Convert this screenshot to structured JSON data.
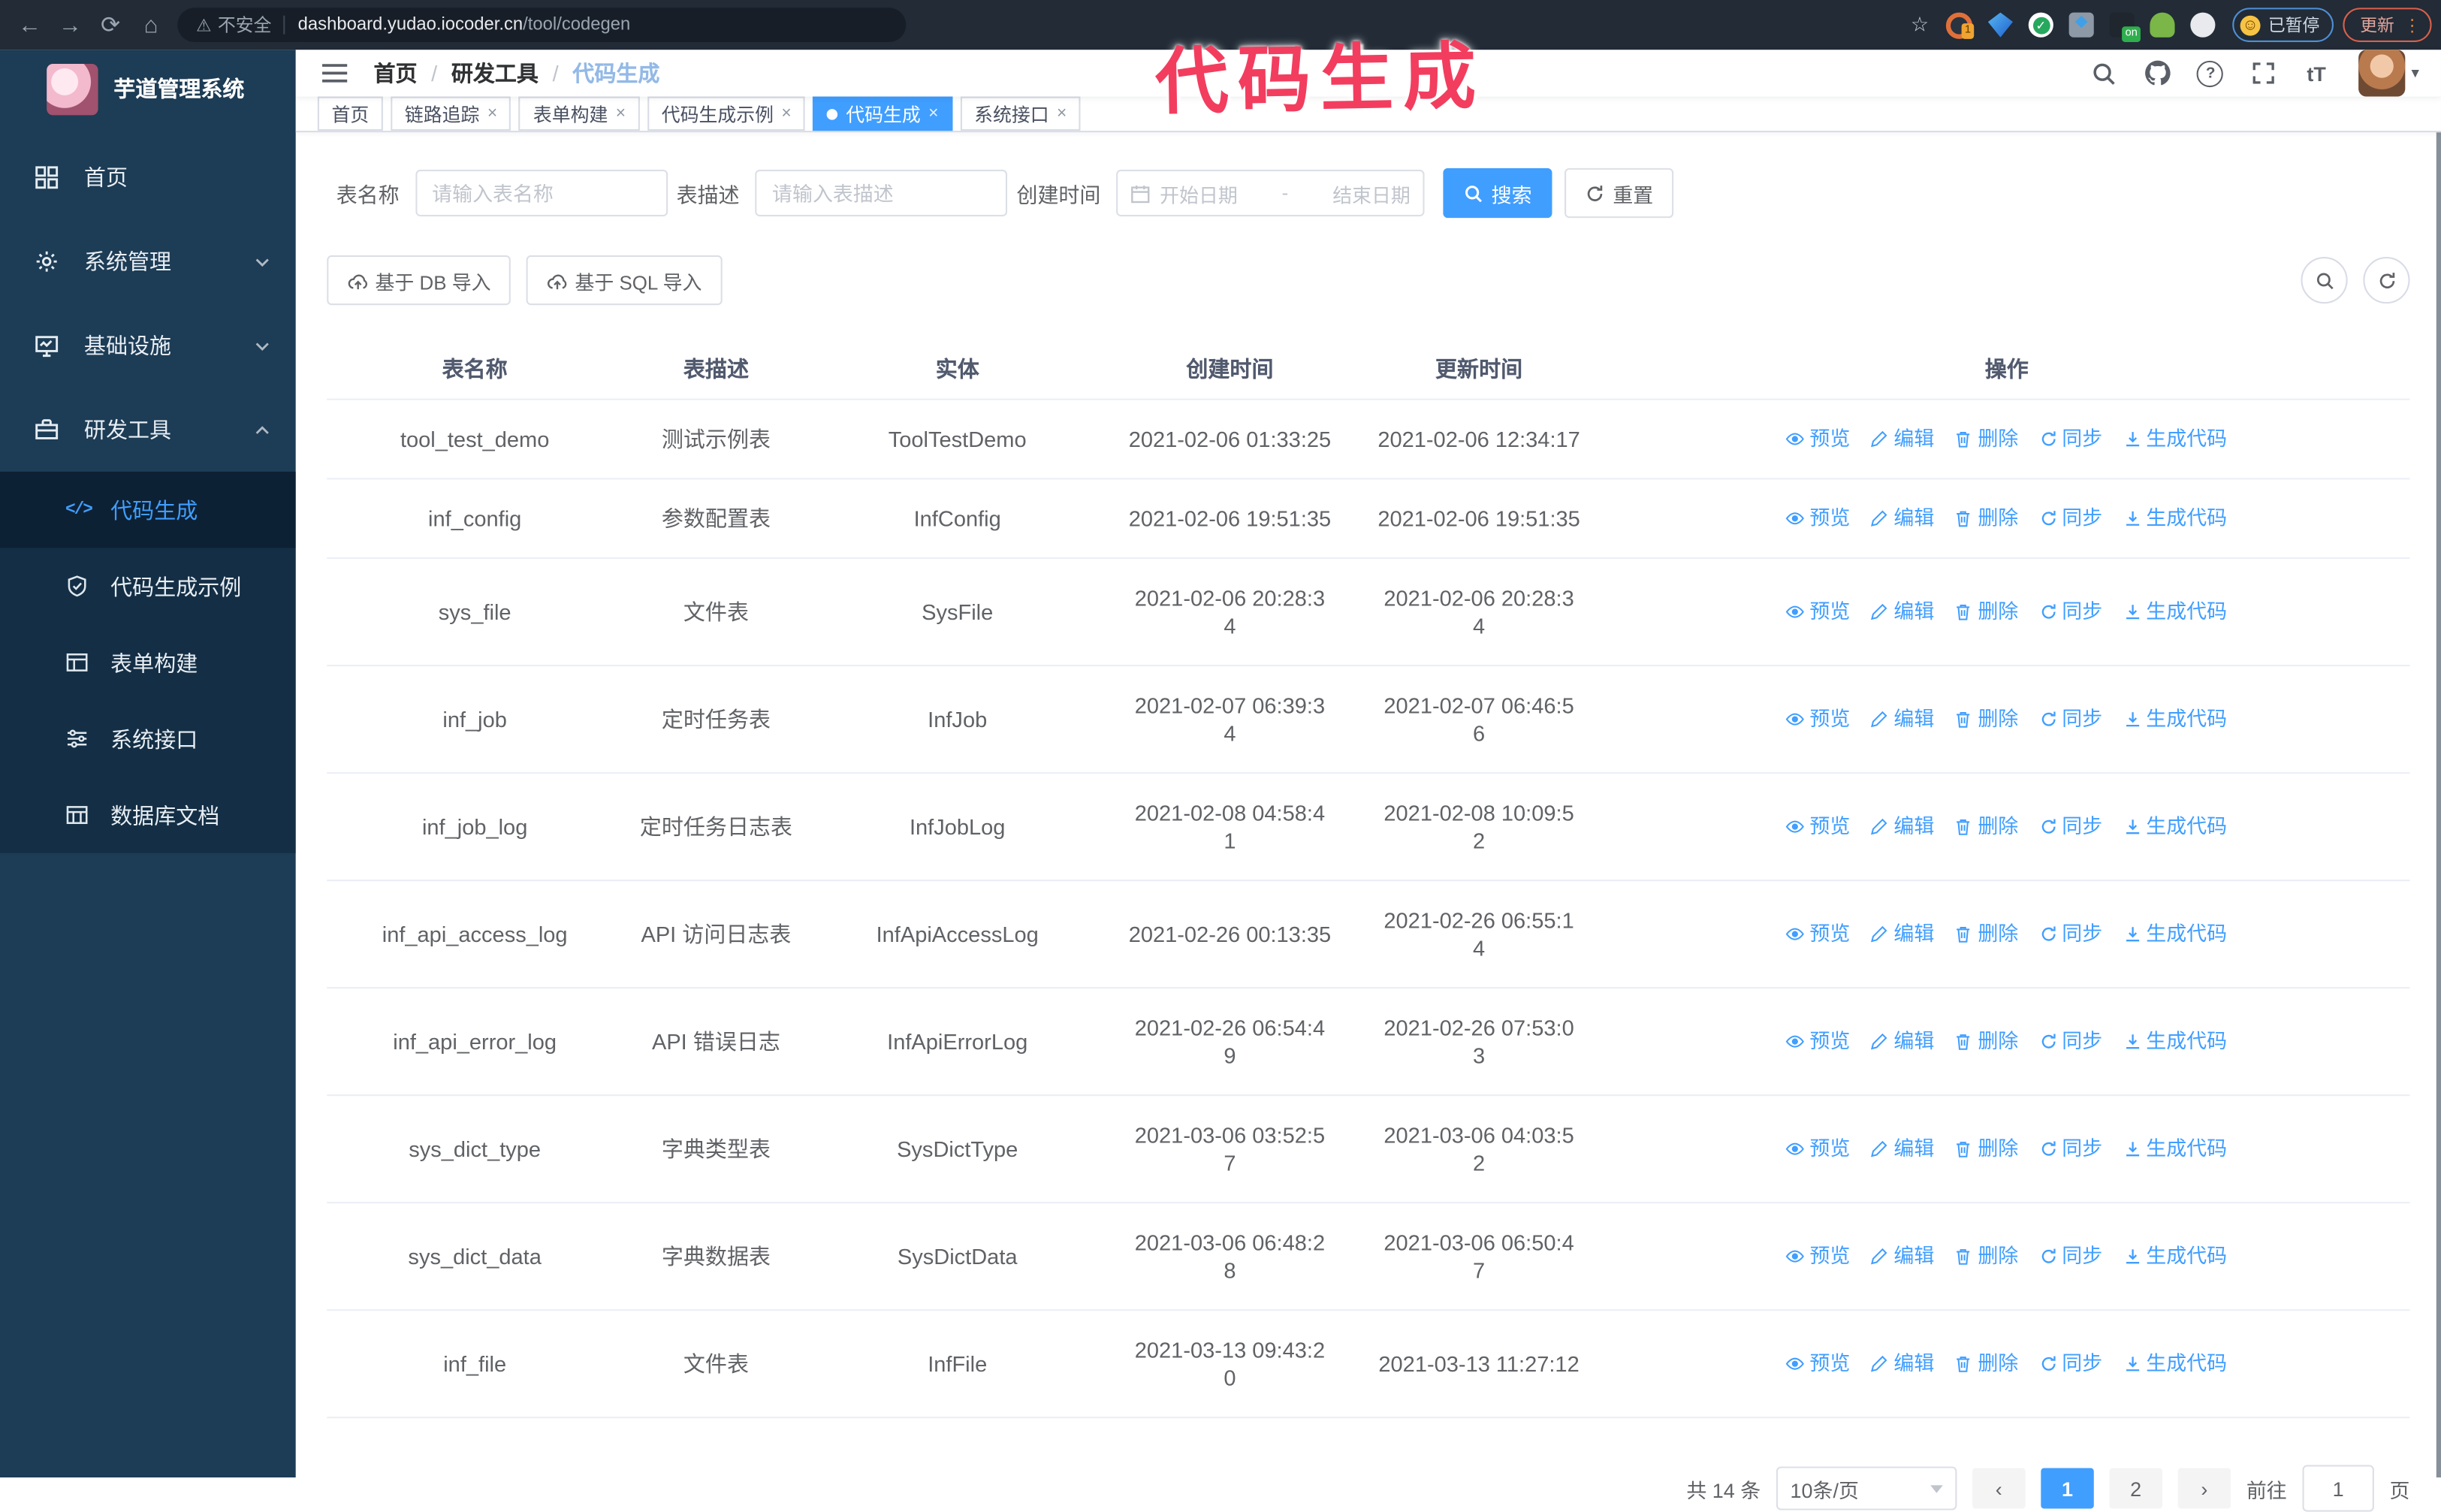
{
  "browser": {
    "security_label": "不安全",
    "url_host": "dashboard.yudao.iocoder.cn",
    "url_path": "/tool/codegen",
    "paused_badge": "已暂停",
    "update_button": "更新"
  },
  "watermark": "代码生成",
  "sidebar": {
    "title": "芋道管理系统",
    "items": [
      {
        "label": "首页"
      },
      {
        "label": "系统管理"
      },
      {
        "label": "基础设施"
      },
      {
        "label": "研发工具"
      }
    ],
    "sub_items": [
      {
        "label": "代码生成"
      },
      {
        "label": "代码生成示例"
      },
      {
        "label": "表单构建"
      },
      {
        "label": "系统接口"
      },
      {
        "label": "数据库文档"
      }
    ]
  },
  "header": {
    "breadcrumb": [
      "首页",
      "研发工具",
      "代码生成"
    ],
    "font_size_icon": "tT"
  },
  "tabs": [
    {
      "label": "首页"
    },
    {
      "label": "链路追踪"
    },
    {
      "label": "表单构建"
    },
    {
      "label": "代码生成示例"
    },
    {
      "label": "代码生成"
    },
    {
      "label": "系统接口"
    }
  ],
  "filters": {
    "name_label": "表名称",
    "name_placeholder": "请输入表名称",
    "desc_label": "表描述",
    "desc_placeholder": "请输入表描述",
    "time_label": "创建时间",
    "start_placeholder": "开始日期",
    "range_separator": "-",
    "end_placeholder": "结束日期",
    "search_label": "搜索",
    "reset_label": "重置"
  },
  "toolbar": {
    "import_db_label": "基于 DB 导入",
    "import_sql_label": "基于 SQL 导入"
  },
  "table": {
    "columns": [
      "表名称",
      "表描述",
      "实体",
      "创建时间",
      "更新时间",
      "操作"
    ],
    "actions": [
      "预览",
      "编辑",
      "删除",
      "同步",
      "生成代码"
    ],
    "rows": [
      {
        "name": "tool_test_demo",
        "desc": "测试示例表",
        "entity": "ToolTestDemo",
        "created": "2021-02-06 01:33:25",
        "updated": "2021-02-06 12:34:17"
      },
      {
        "name": "inf_config",
        "desc": "参数配置表",
        "entity": "InfConfig",
        "created": "2021-02-06 19:51:35",
        "updated": "2021-02-06 19:51:35"
      },
      {
        "name": "sys_file",
        "desc": "文件表",
        "entity": "SysFile",
        "created": "2021-02-06 20:28:3\n4",
        "updated": "2021-02-06 20:28:3\n4"
      },
      {
        "name": "inf_job",
        "desc": "定时任务表",
        "entity": "InfJob",
        "created": "2021-02-07 06:39:3\n4",
        "updated": "2021-02-07 06:46:5\n6"
      },
      {
        "name": "inf_job_log",
        "desc": "定时任务日志表",
        "entity": "InfJobLog",
        "created": "2021-02-08 04:58:4\n1",
        "updated": "2021-02-08 10:09:5\n2"
      },
      {
        "name": "inf_api_access_log",
        "desc": "API 访问日志表",
        "entity": "InfApiAccessLog",
        "created": "2021-02-26 00:13:35",
        "updated": "2021-02-26 06:55:1\n4"
      },
      {
        "name": "inf_api_error_log",
        "desc": "API 错误日志",
        "entity": "InfApiErrorLog",
        "created": "2021-02-26 06:54:4\n9",
        "updated": "2021-02-26 07:53:0\n3"
      },
      {
        "name": "sys_dict_type",
        "desc": "字典类型表",
        "entity": "SysDictType",
        "created": "2021-03-06 03:52:5\n7",
        "updated": "2021-03-06 04:03:5\n2"
      },
      {
        "name": "sys_dict_data",
        "desc": "字典数据表",
        "entity": "SysDictData",
        "created": "2021-03-06 06:48:2\n8",
        "updated": "2021-03-06 06:50:4\n7"
      },
      {
        "name": "inf_file",
        "desc": "文件表",
        "entity": "InfFile",
        "created": "2021-03-13 09:43:2\n0",
        "updated": "2021-03-13 11:27:12"
      }
    ]
  },
  "pagination": {
    "total": "共 14 条",
    "page_size": "10条/页",
    "page_1": "1",
    "page_2": "2",
    "goto_label": "前往",
    "goto_value": "1",
    "goto_suffix": "页"
  }
}
